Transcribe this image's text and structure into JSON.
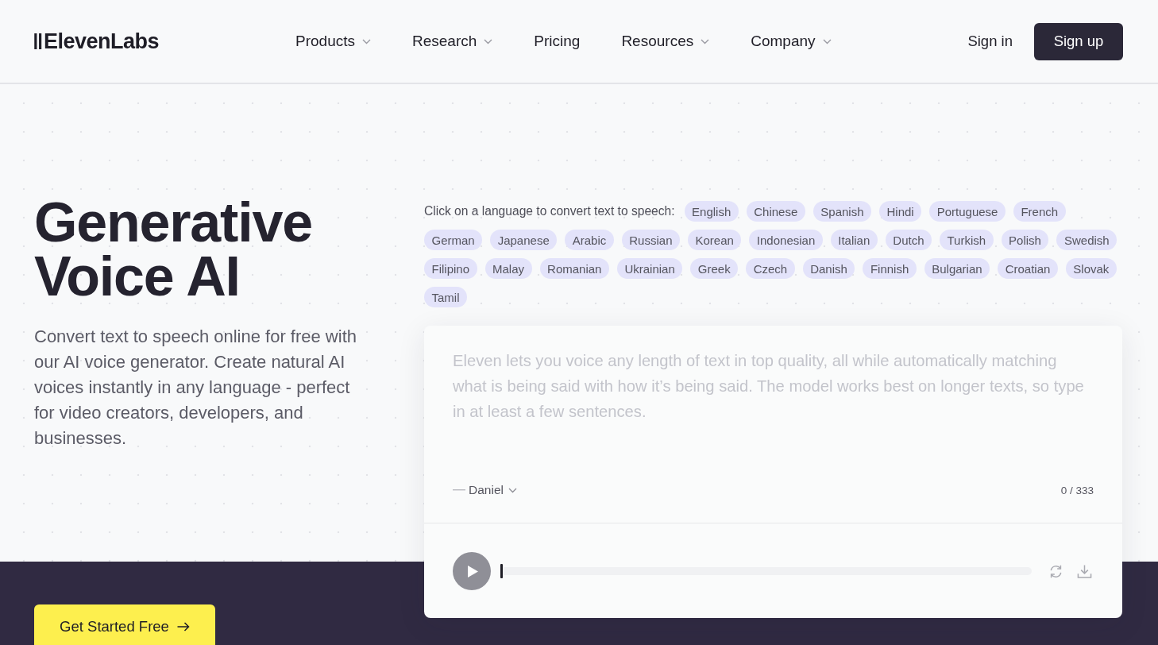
{
  "header": {
    "brand": "ElevenLabs",
    "nav": [
      {
        "label": "Products",
        "has_menu": true
      },
      {
        "label": "Research",
        "has_menu": true
      },
      {
        "label": "Pricing",
        "has_menu": false
      },
      {
        "label": "Resources",
        "has_menu": true
      },
      {
        "label": "Company",
        "has_menu": true
      }
    ],
    "sign_in": "Sign in",
    "sign_up": "Sign up"
  },
  "hero": {
    "title": "Generative Voice AI",
    "description": "Convert text to speech online for free with our AI voice generator. Create natural AI voices instantly in any language - perfect for video creators, developers, and businesses.",
    "cta": "Get Started Free"
  },
  "demo": {
    "prompt": "Click on a language to convert text to speech:",
    "languages": [
      "English",
      "Chinese",
      "Spanish",
      "Hindi",
      "Portuguese",
      "French",
      "German",
      "Japanese",
      "Arabic",
      "Russian",
      "Korean",
      "Indonesian",
      "Italian",
      "Dutch",
      "Turkish",
      "Polish",
      "Swedish",
      "Filipino",
      "Malay",
      "Romanian",
      "Ukrainian",
      "Greek",
      "Czech",
      "Danish",
      "Finnish",
      "Bulgarian",
      "Croatian",
      "Slovak",
      "Tamil"
    ],
    "placeholder": "Eleven lets you voice any length of text in top quality, all while automatically matching what is being said with how it’s being said. The model works best on longer texts, so type in at least a few sentences.",
    "voice": "Daniel",
    "counter": "0 / 333",
    "player": {
      "level": 0
    }
  }
}
